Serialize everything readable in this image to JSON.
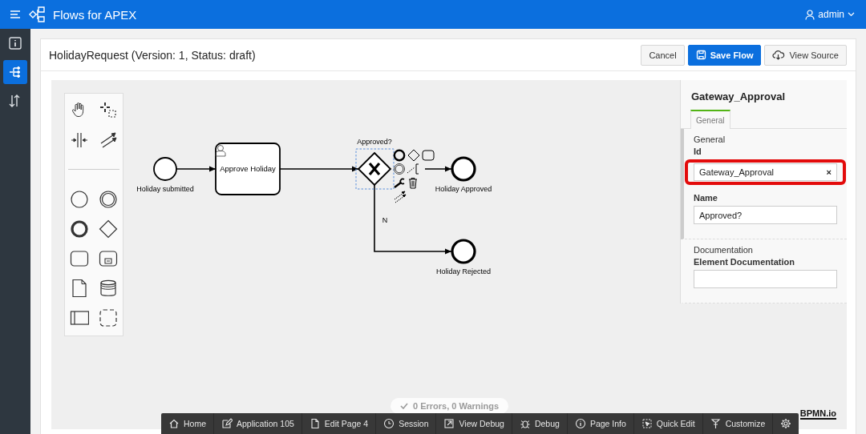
{
  "app": {
    "title": "Flows for APEX",
    "user": "admin"
  },
  "nav": [
    {
      "selected": false
    },
    {
      "selected": true
    },
    {
      "selected": false
    }
  ],
  "header": {
    "title": "HolidayRequest (Version: 1, Status: draft)",
    "buttons": [
      {
        "label": "Cancel",
        "kind": "plain"
      },
      {
        "label": "Save Flow",
        "kind": "primary"
      },
      {
        "label": "View Source",
        "kind": "source"
      }
    ]
  },
  "diagram": {
    "nodes": [
      {
        "kind": "start",
        "label": "Holiday submitted",
        "selected": false
      },
      {
        "kind": "task",
        "label": "Approve Holiday",
        "selected": false
      },
      {
        "kind": "gateway",
        "label": "Approved?",
        "selected": true,
        "branch_label": "N"
      },
      {
        "kind": "end",
        "label": "Holiday Approved",
        "selected": false
      },
      {
        "kind": "end",
        "label": "Holiday Rejected",
        "selected": false
      }
    ],
    "validation": "0 Errors, 0 Warnings",
    "logo": "BPMN.io"
  },
  "properties": {
    "element": "Gateway_Approval",
    "tabs": [
      {
        "label": "General",
        "selected": true
      }
    ],
    "groups": [
      {
        "title": "General",
        "fields": [
          {
            "label": "Id",
            "kind": "input",
            "value": "Gateway_Approval",
            "clear": "×",
            "highlighted": true
          },
          {
            "label": "Name",
            "kind": "textarea",
            "value": "Approved?",
            "highlighted": false
          }
        ]
      },
      {
        "title": "Documentation",
        "fields": [
          {
            "label": "Element Documentation",
            "kind": "textarea",
            "highlighted": false
          }
        ]
      }
    ]
  },
  "dev_toolbar": [
    {
      "label": "Home"
    },
    {
      "label": "Application 105"
    },
    {
      "label": "Edit Page 4"
    },
    {
      "label": "Session"
    },
    {
      "label": "View Debug"
    },
    {
      "label": "Debug"
    },
    {
      "label": "Page Info"
    },
    {
      "label": "Quick Edit"
    },
    {
      "label": "Customize"
    }
  ]
}
